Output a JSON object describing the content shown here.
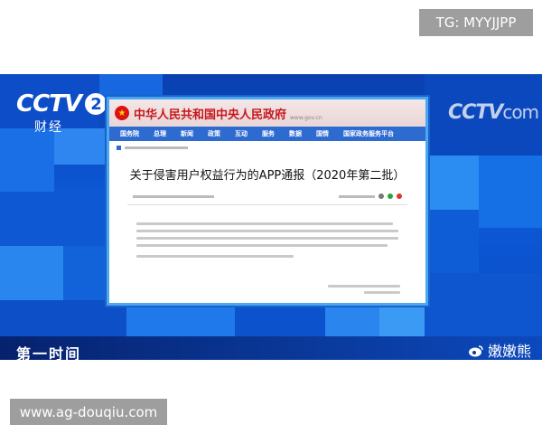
{
  "watermark_top": "TG: MYYJJPP",
  "watermark_bottom": "www.ag-douqiu.com",
  "channel_logo": {
    "brand": "CCTV",
    "number": "2",
    "subtitle": "财经"
  },
  "right_logo": {
    "brand": "CCTV",
    "suffix": "com"
  },
  "program_name": "第一时间",
  "weibo_user": "嫩嫩熊",
  "gov_site": {
    "title": "中华人民共和国中央人民政府",
    "url": "www.gov.cn",
    "nav": [
      "国务院",
      "总理",
      "新闻",
      "政策",
      "互动",
      "服务",
      "数据",
      "国情",
      "国家政务服务平台"
    ],
    "doc_title": "关于侵害用户权益行为的APP通报（2020年第二批）"
  },
  "colors": {
    "gov_red": "#c8161d",
    "nav_blue": "#2e6bd1",
    "panel_border": "#4aa7f2"
  }
}
